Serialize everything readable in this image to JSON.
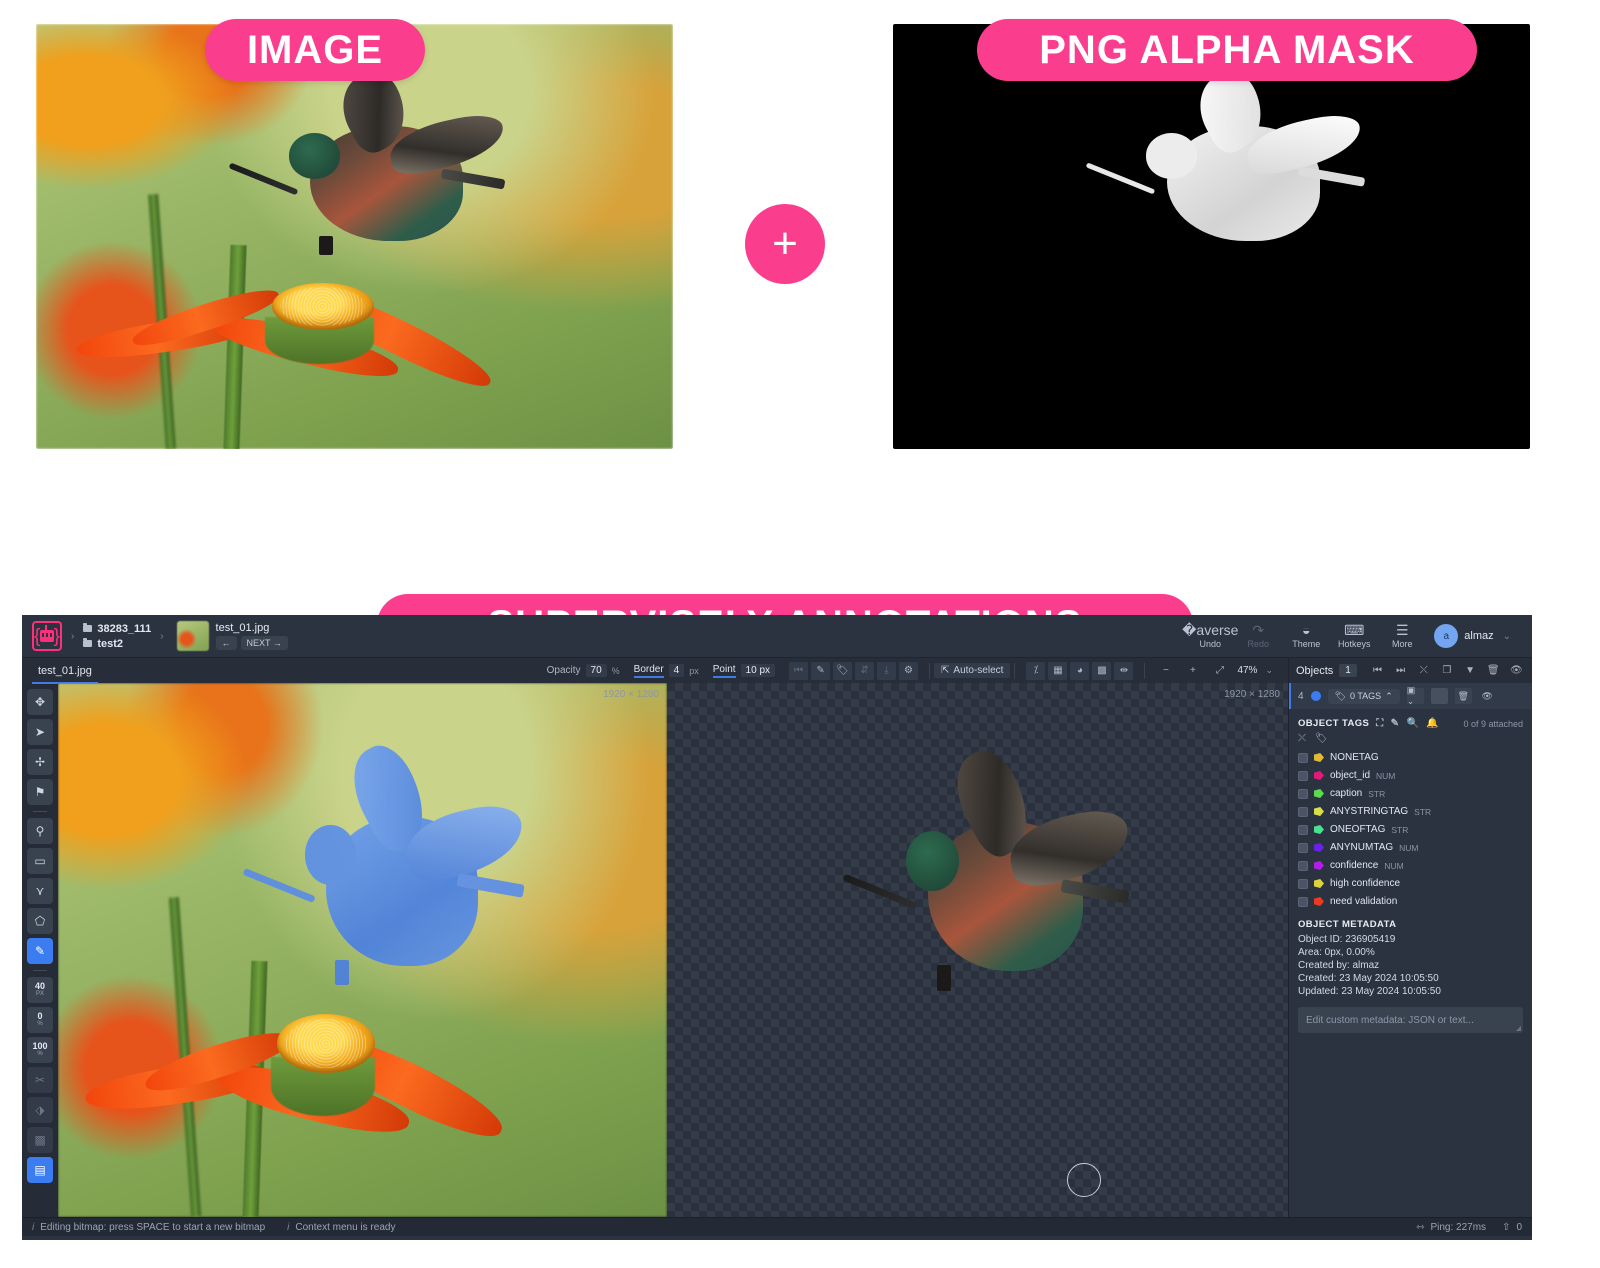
{
  "callouts": {
    "image_label": "IMAGE",
    "mask_label": "PNG ALPHA MASK",
    "annotations_label": "SUPERVISELY ANNOTATIONS",
    "plus": "+"
  },
  "app": {
    "header": {
      "project": "38283_111",
      "dataset": "test2",
      "file_name": "test_01.jpg",
      "prev_label": "←",
      "next_label": "NEXT →",
      "undo": "Undo",
      "redo": "Redo",
      "theme": "Theme",
      "hotkeys": "Hotkeys",
      "more": "More",
      "user_initial": "a",
      "user_name": "almaz"
    },
    "toolbar": {
      "tab_label": "test_01.jpg",
      "opacity_label": "Opacity",
      "opacity_value": "70",
      "opacity_unit": "%",
      "border_label": "Border",
      "border_value": "4",
      "border_unit": "px",
      "point_label": "Point",
      "point_value": "10 px",
      "auto_select": "Auto-select",
      "zoom_value": "47%"
    },
    "objects_panel": {
      "title": "Objects",
      "count": "1",
      "object_index": "4",
      "tags_chip": "0 TAGS",
      "object_tags_title": "OBJECT TAGS",
      "attached_note": "0 of 9 attached",
      "tags": [
        {
          "name": "NONETAG",
          "type": "",
          "color": "#e3b93a"
        },
        {
          "name": "object_id",
          "type": "NUM",
          "color": "#e3197a"
        },
        {
          "name": "caption",
          "type": "STR",
          "color": "#5ddb4f"
        },
        {
          "name": "ANYSTRINGTAG",
          "type": "STR",
          "color": "#d7de4a"
        },
        {
          "name": "ONEOFTAG",
          "type": "STR",
          "color": "#4be08f"
        },
        {
          "name": "ANYNUMTAG",
          "type": "NUM",
          "color": "#6a21e8"
        },
        {
          "name": "confidence",
          "type": "NUM",
          "color": "#b21de8"
        },
        {
          "name": "high confidence",
          "type": "",
          "color": "#dcd43f"
        },
        {
          "name": "need validation",
          "type": "",
          "color": "#e83b22"
        }
      ],
      "metadata_title": "OBJECT METADATA",
      "metadata_lines": [
        "Object ID: 236905419",
        "Area: 0px, 0.00%",
        "Created by: almaz",
        "Created: 23 May 2024 10:05:50",
        "Updated: 23 May 2024 10:05:50"
      ],
      "metadata_placeholder": "Edit custom metadata: JSON or text..."
    },
    "canvas": {
      "left_dimensions": "1920 × 1280",
      "right_dimensions": "1920 × 1280"
    },
    "status_bar": {
      "message_1": "Editing bitmap: press SPACE to start a new bitmap",
      "message_2": "Context menu is ready",
      "ping": "Ping: 227ms",
      "upload_count": "0"
    },
    "left_tools": [
      {
        "name": "move-tool",
        "glyph": "✥",
        "state": "normal"
      },
      {
        "name": "select-tool",
        "glyph": "➤",
        "state": "normal"
      },
      {
        "name": "drag-tool",
        "glyph": "✢",
        "state": "normal"
      },
      {
        "name": "flag-tool",
        "glyph": "⚑",
        "state": "normal"
      },
      {
        "name": "point-tool",
        "glyph": "⚲",
        "state": "normal"
      },
      {
        "name": "rectangle-tool",
        "glyph": "▭",
        "state": "normal"
      },
      {
        "name": "polyline-tool",
        "glyph": "⋎",
        "state": "normal"
      },
      {
        "name": "polygon-tool",
        "glyph": "⬠",
        "state": "normal"
      },
      {
        "name": "brush-tool",
        "glyph": "✎",
        "state": "accent"
      }
    ],
    "brush_settings": [
      {
        "name": "brush-size",
        "num": "40",
        "sub": "PX"
      },
      {
        "name": "brush-hardness",
        "num": "0",
        "sub": "%"
      },
      {
        "name": "brush-opacity",
        "num": "100",
        "sub": "%"
      }
    ],
    "extra_tools": [
      {
        "name": "scissors-tool",
        "glyph": "✂",
        "state": "dim"
      },
      {
        "name": "fill-tool",
        "glyph": "⬗",
        "state": "dim"
      },
      {
        "name": "mask-tool",
        "glyph": "▦",
        "state": "dim"
      },
      {
        "name": "bitmap-tool",
        "glyph": "▤",
        "state": "accent"
      }
    ]
  },
  "colors": {
    "pink": "#fb3d8e",
    "accent_blue": "#3b7df0",
    "panel_bg": "#2b3341"
  }
}
